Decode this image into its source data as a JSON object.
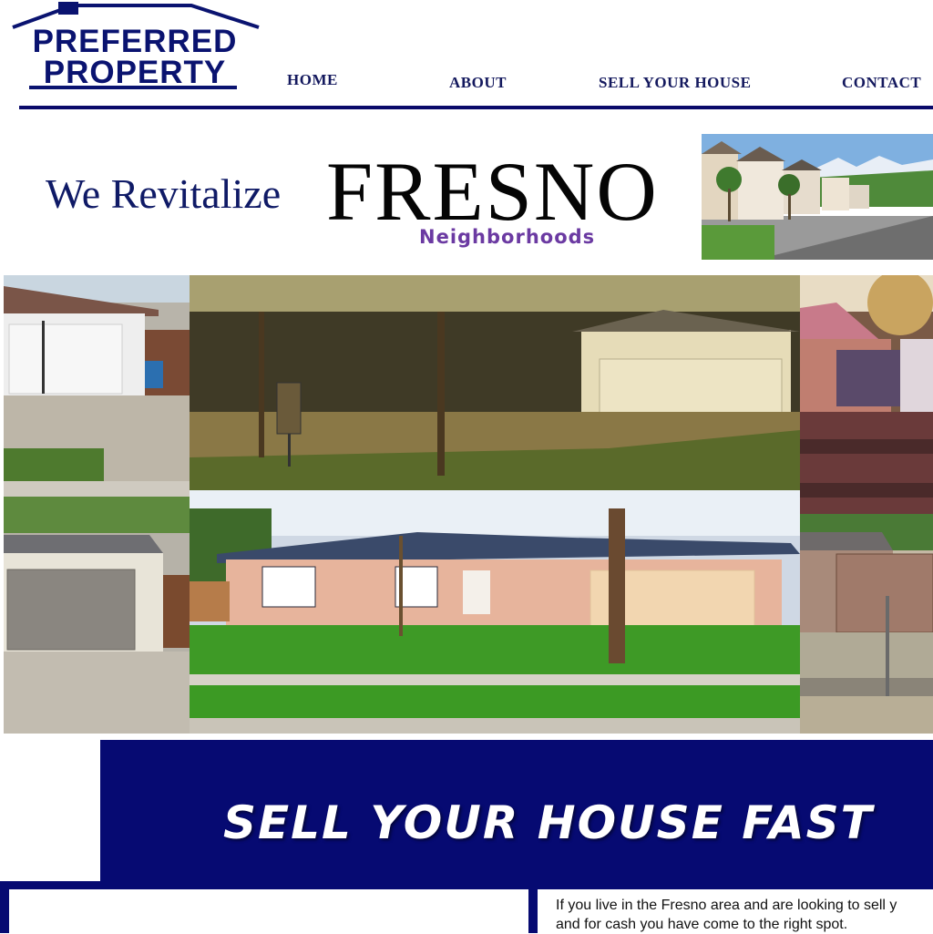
{
  "logo": {
    "line1": "PREFERRED",
    "line2": "PROPERTY"
  },
  "nav": {
    "home": "HOME",
    "about": "ABOUT",
    "sell": "SELL YOUR HOUSE",
    "contact": "CONTACT"
  },
  "hero": {
    "prefix": "We Revitalize",
    "city": "FRESNO",
    "tagline": "Neighborhoods"
  },
  "banner": {
    "headline": "SELL YOUR HOUSE FAST"
  },
  "intro": {
    "line1": "If you live in the Fresno area and are looking to sell y",
    "line2": "and for cash you have come to the right spot."
  },
  "colors": {
    "brand_navy": "#0a1370",
    "banner_blue": "#060a72",
    "tagline_purple": "#6b3aa2"
  }
}
